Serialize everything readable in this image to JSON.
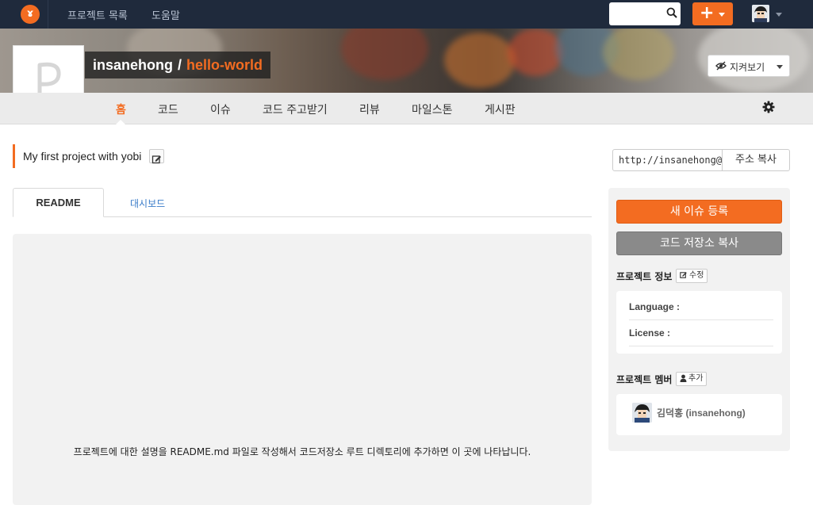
{
  "nav": {
    "logo_glyph": "ɤ",
    "links": [
      "프로젝트 목록",
      "도움말"
    ],
    "search_placeholder": "",
    "new_label": "+"
  },
  "project": {
    "owner": "insanehong",
    "separator": "/",
    "name": "hello-world",
    "logo_letter": "P",
    "watch_label": "지켜보기",
    "description": "My first project with yobi"
  },
  "tabs": [
    "홈",
    "코드",
    "이슈",
    "코드 주고받기",
    "리뷰",
    "마일스톤",
    "게시판"
  ],
  "active_tab": "홈",
  "content": {
    "tabs": [
      "README",
      "대시보드"
    ],
    "readme_message": "프로젝트에 대한 설명을 README.md 파일로 작성해서 코드저장소 루트 디렉토리에 추가하면 이 곳에 나타납니다."
  },
  "clone": {
    "url": "http://insanehong@",
    "copy_label": "주소 복사"
  },
  "sidebar": {
    "new_issue_label": "새 이슈 등록",
    "fork_label": "코드 저장소 복사",
    "info_title": "프로젝트 정보",
    "edit_label": "수정",
    "info_rows": [
      "Language :",
      "License :"
    ],
    "members_title": "프로젝트 멤버",
    "add_label": "추가",
    "members": [
      "김덕홍 (insanehong)"
    ]
  },
  "colors": {
    "accent": "#f36c21",
    "navbar": "#1f2a3c",
    "link": "#3a7cc9"
  }
}
